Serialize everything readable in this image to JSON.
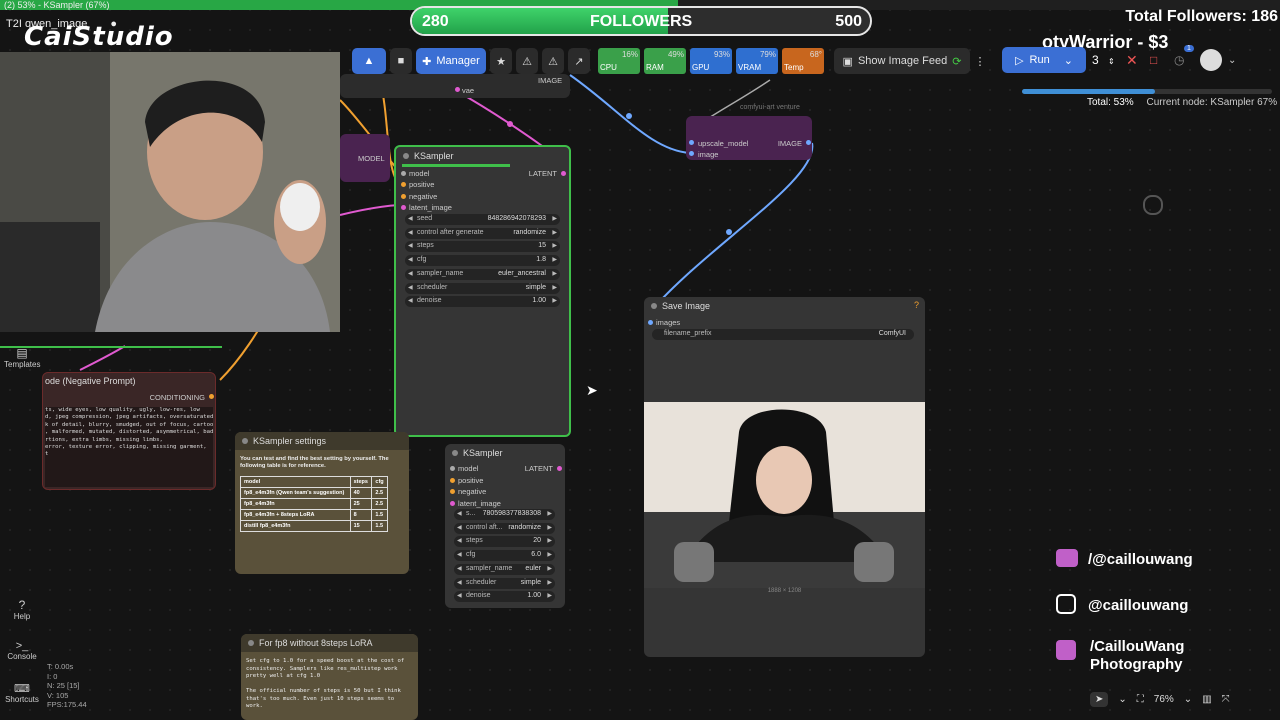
{
  "browser": {
    "tab_title": "(2) 53% - KSampler (67%)",
    "tab_label": "T2I qwen_image",
    "progress_percent": 53
  },
  "overlay": {
    "logo": "CaiStudio",
    "followers_current": "280",
    "followers_label": "FOLLOWERS",
    "followers_goal": "500",
    "followers_fraction": 0.56,
    "total_followers": "Total Followers: 186",
    "donor_ticker": "otyWarrior - $3",
    "socials": [
      "/@caillouwang",
      "@caillouwang",
      "/CaillouWang",
      "Photography"
    ]
  },
  "toolbar": {
    "manager_label": "Manager",
    "meters": [
      {
        "label": "CPU",
        "pct": "16%",
        "color": "#3aa04a"
      },
      {
        "label": "RAM",
        "pct": "49%",
        "color": "#3aa04a"
      },
      {
        "label": "GPU",
        "pct": "93%",
        "color": "#2f6fd0"
      },
      {
        "label": "VRAM",
        "pct": "79%",
        "color": "#2f6fd0"
      },
      {
        "label": "Temp",
        "pct": "68°",
        "color": "#c8661e"
      }
    ],
    "feed_label": "Show Image Feed",
    "run_label": "Run",
    "batch_count": "3",
    "notification_badge": "1"
  },
  "progress": {
    "total": "Total: 53%",
    "current": "Current node: KSampler 67%",
    "fraction": 0.53
  },
  "nodes": {
    "ksampler_main": {
      "title": "KSampler",
      "inputs": [
        "model",
        "positive",
        "negative",
        "latent_image"
      ],
      "output": "LATENT",
      "widgets": [
        {
          "k": "seed",
          "v": "848286942078293"
        },
        {
          "k": "control after generate",
          "v": "randomize"
        },
        {
          "k": "steps",
          "v": "15"
        },
        {
          "k": "cfg",
          "v": "1.8"
        },
        {
          "k": "sampler_name",
          "v": "euler_ancestral"
        },
        {
          "k": "scheduler",
          "v": "simple"
        },
        {
          "k": "denoise",
          "v": "1.00"
        }
      ]
    },
    "ksampler_second": {
      "title": "KSampler",
      "inputs": [
        "model",
        "positive",
        "negative",
        "latent_image"
      ],
      "output": "LATENT",
      "widgets": [
        {
          "k": "s...",
          "v": "780598377838308"
        },
        {
          "k": "control aft...",
          "v": "randomize"
        },
        {
          "k": "steps",
          "v": "20"
        },
        {
          "k": "cfg",
          "v": "6.0"
        },
        {
          "k": "sampler_name",
          "v": "euler"
        },
        {
          "k": "scheduler",
          "v": "simple"
        },
        {
          "k": "denoise",
          "v": "1.00"
        }
      ]
    },
    "upscale": {
      "group_title": "comfyui-art venture",
      "inputs": [
        "upscale_model",
        "image"
      ],
      "output": "IMAGE"
    },
    "vae_node": {
      "input": "vae",
      "output_label": "IMAGE"
    },
    "model_partial": {
      "label": "MODEL"
    },
    "save_image": {
      "title": "Save Image",
      "input": "images",
      "prefix_key": "filename_prefix",
      "prefix_value": "ComfyUI",
      "dimensions": "1888 × 1208"
    },
    "negative_prompt": {
      "title": "ode (Negative Prompt)",
      "output": "CONDITIONING",
      "text": "ts, wide eyes, low quality, ugly, low-res, low\nd, jpeg compression, jpeg artifacts, oversaturated,\nk of detail, blurry, smudged, out of focus, cartoon,\n, malformed, mutated, distorted, asymmetrical, bad\nrtions, extra limbs, missing limbs,\nerror, texture error, clipping, missing garment,\nt"
    },
    "ksampler_settings": {
      "title": "KSampler settings",
      "intro": "You can test and find the best setting by yourself. The following table is for reference.",
      "headers": [
        "model",
        "steps",
        "cfg"
      ],
      "rows": [
        [
          "fp8_e4m3fn  (Qwen team's suggestion)",
          "40",
          "2.5"
        ],
        [
          "fp8_e4m3fn",
          "25",
          "2.5"
        ],
        [
          "fp8_e4m3fn + 8steps LoRA",
          "8",
          "1.5"
        ],
        [
          "distill fp8_e4m3fn",
          "15",
          "1.5"
        ]
      ]
    },
    "fp8_note": {
      "title": "For fp8 without 8steps LoRA",
      "text": "Set cfg to 1.0 for a speed boost at the cost of consistency. Samplers like res_multistep work pretty well at cfg 1.0\n\nThe official number of steps is 50 but I think that's too much. Even just 10 steps seems to work."
    }
  },
  "sidebar": {
    "templates": "Templates",
    "help": "Help",
    "console": "Console",
    "shortcuts": "Shortcuts"
  },
  "stats": {
    "t": "T: 0.00s",
    "i": "I: 0",
    "n": "N: 25 [15]",
    "v": "V: 105",
    "fps": "FPS:175.44"
  },
  "bottom": {
    "zoom": "76%"
  }
}
